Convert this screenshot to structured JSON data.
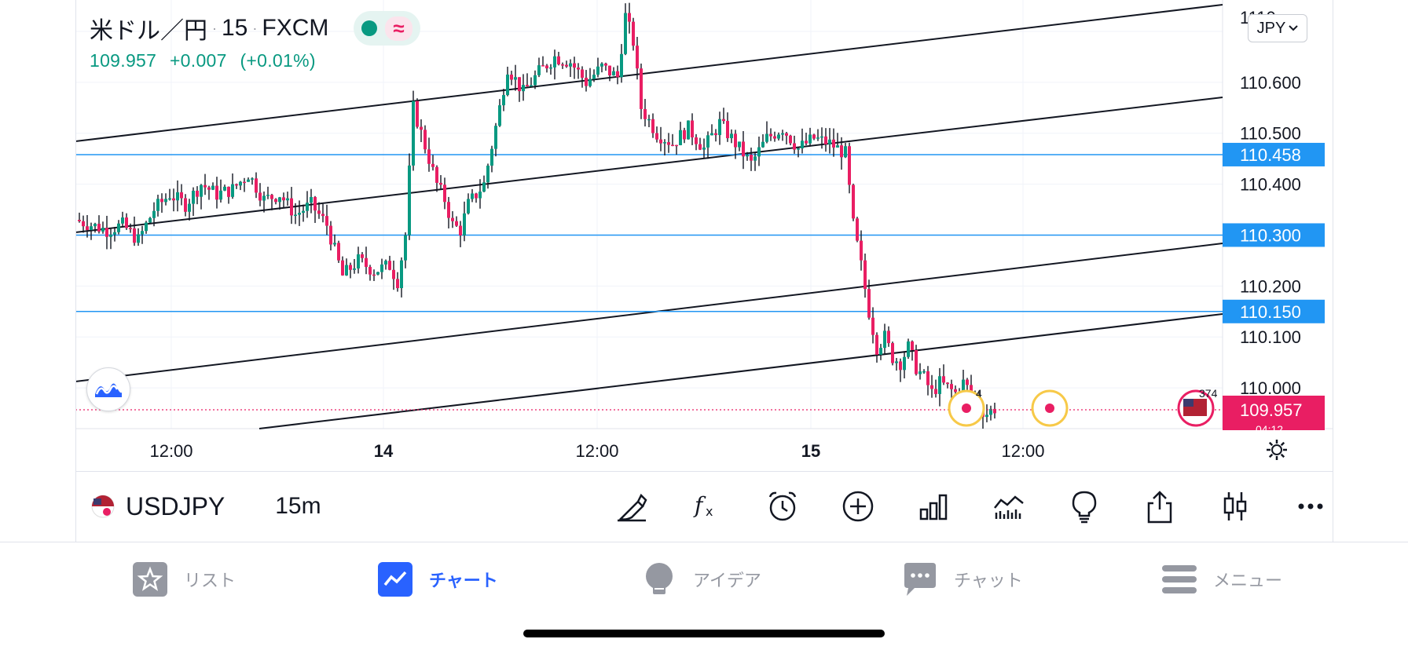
{
  "header": {
    "symbol_name": "米ドル／円",
    "interval": "15",
    "exchange": "FXCM",
    "last": "109.957",
    "change": "+0.007",
    "change_pct": "(+0.01%)",
    "currency_btn": "JPY",
    "chevron_icon": "chevron-down-icon"
  },
  "axis": {
    "price_ticks": [
      "110.600",
      "110.500",
      "110.400",
      "110.200",
      "110.100",
      "110.000"
    ],
    "time_ticks": [
      "12:00",
      "14",
      "12:00",
      "15",
      "12:00"
    ],
    "top_tick_partial": "1110"
  },
  "hlines": [
    {
      "label": "110.458",
      "color": "#2196f3"
    },
    {
      "label": "110.300",
      "color": "#2196f3"
    },
    {
      "label": "110.150",
      "color": "#2196f3"
    }
  ],
  "current_price_label": "109.957",
  "current_price_sub": "04:12",
  "current_price_color": "#e91e63",
  "events": {
    "earnings_count": "4",
    "us_event_count": "374"
  },
  "colors": {
    "up": "#089981",
    "down": "#e91e63",
    "accent": "#2962ff",
    "hline": "#2196f3",
    "event_ring": "#f7c948"
  },
  "toolbar": {
    "symbol": "USDJPY",
    "timeframe": "15m",
    "icons": [
      "drawing-pen-icon",
      "indicators-fx-icon",
      "alarm-clock-icon",
      "add-circle-icon",
      "bar-chart-icon",
      "volume-indicator-icon",
      "idea-lightbulb-icon",
      "share-icon",
      "candles-style-icon",
      "more-icon"
    ]
  },
  "tabs": [
    {
      "label": "リスト",
      "icon": "star-icon",
      "active": false
    },
    {
      "label": "チャート",
      "icon": "chart-line-icon",
      "active": true
    },
    {
      "label": "アイデア",
      "icon": "lightbulb-icon",
      "active": false
    },
    {
      "label": "チャット",
      "icon": "chat-icon",
      "active": false
    },
    {
      "label": "メニュー",
      "icon": "menu-icon",
      "active": false
    }
  ],
  "chart_data": {
    "type": "candlestick",
    "symbol": "USDJPY",
    "interval": "15m",
    "ylim": [
      109.92,
      110.74
    ],
    "horizontal_levels": [
      110.458,
      110.3,
      110.15
    ],
    "last_price": 109.957,
    "x_tick_labels": [
      "12:00",
      "14",
      "12:00",
      "15",
      "12:00"
    ],
    "close_path": [
      [
        0,
        110.33
      ],
      [
        8,
        110.31
      ],
      [
        12,
        110.32
      ],
      [
        16,
        110.29
      ],
      [
        20,
        110.35
      ],
      [
        24,
        110.38
      ],
      [
        28,
        110.36
      ],
      [
        32,
        110.4
      ],
      [
        36,
        110.38
      ],
      [
        40,
        110.39
      ],
      [
        44,
        110.42
      ],
      [
        48,
        110.37
      ],
      [
        52,
        110.38
      ],
      [
        56,
        110.34
      ],
      [
        60,
        110.36
      ],
      [
        64,
        110.32
      ],
      [
        68,
        110.22
      ],
      [
        72,
        110.25
      ],
      [
        76,
        110.23
      ],
      [
        80,
        110.24
      ],
      [
        82,
        110.21
      ],
      [
        84,
        110.3
      ],
      [
        86,
        110.55
      ],
      [
        88,
        110.5
      ],
      [
        90,
        110.45
      ],
      [
        92,
        110.4
      ],
      [
        94,
        110.37
      ],
      [
        96,
        110.32
      ],
      [
        98,
        110.31
      ],
      [
        100,
        110.36
      ],
      [
        104,
        110.4
      ],
      [
        108,
        110.55
      ],
      [
        110,
        110.63
      ],
      [
        114,
        110.58
      ],
      [
        118,
        110.62
      ],
      [
        122,
        110.65
      ],
      [
        126,
        110.64
      ],
      [
        130,
        110.6
      ],
      [
        134,
        110.63
      ],
      [
        138,
        110.61
      ],
      [
        140,
        110.73
      ],
      [
        142,
        110.68
      ],
      [
        144,
        110.55
      ],
      [
        148,
        110.5
      ],
      [
        152,
        110.48
      ],
      [
        156,
        110.51
      ],
      [
        160,
        110.47
      ],
      [
        164,
        110.52
      ],
      [
        168,
        110.48
      ],
      [
        172,
        110.44
      ],
      [
        176,
        110.49
      ],
      [
        180,
        110.51
      ],
      [
        184,
        110.47
      ],
      [
        188,
        110.49
      ],
      [
        192,
        110.48
      ],
      [
        196,
        110.46
      ],
      [
        198,
        110.32
      ],
      [
        200,
        110.24
      ],
      [
        202,
        110.15
      ],
      [
        204,
        110.08
      ],
      [
        206,
        110.1
      ],
      [
        208,
        110.06
      ],
      [
        210,
        110.05
      ],
      [
        212,
        110.08
      ],
      [
        214,
        110.04
      ],
      [
        216,
        110.02
      ],
      [
        218,
        109.99
      ],
      [
        220,
        110.01
      ],
      [
        222,
        110.0
      ],
      [
        224,
        109.99
      ],
      [
        226,
        110.01
      ],
      [
        228,
        109.99
      ],
      [
        230,
        109.96
      ],
      [
        232,
        109.95
      ],
      [
        234,
        109.96
      ]
    ]
  }
}
